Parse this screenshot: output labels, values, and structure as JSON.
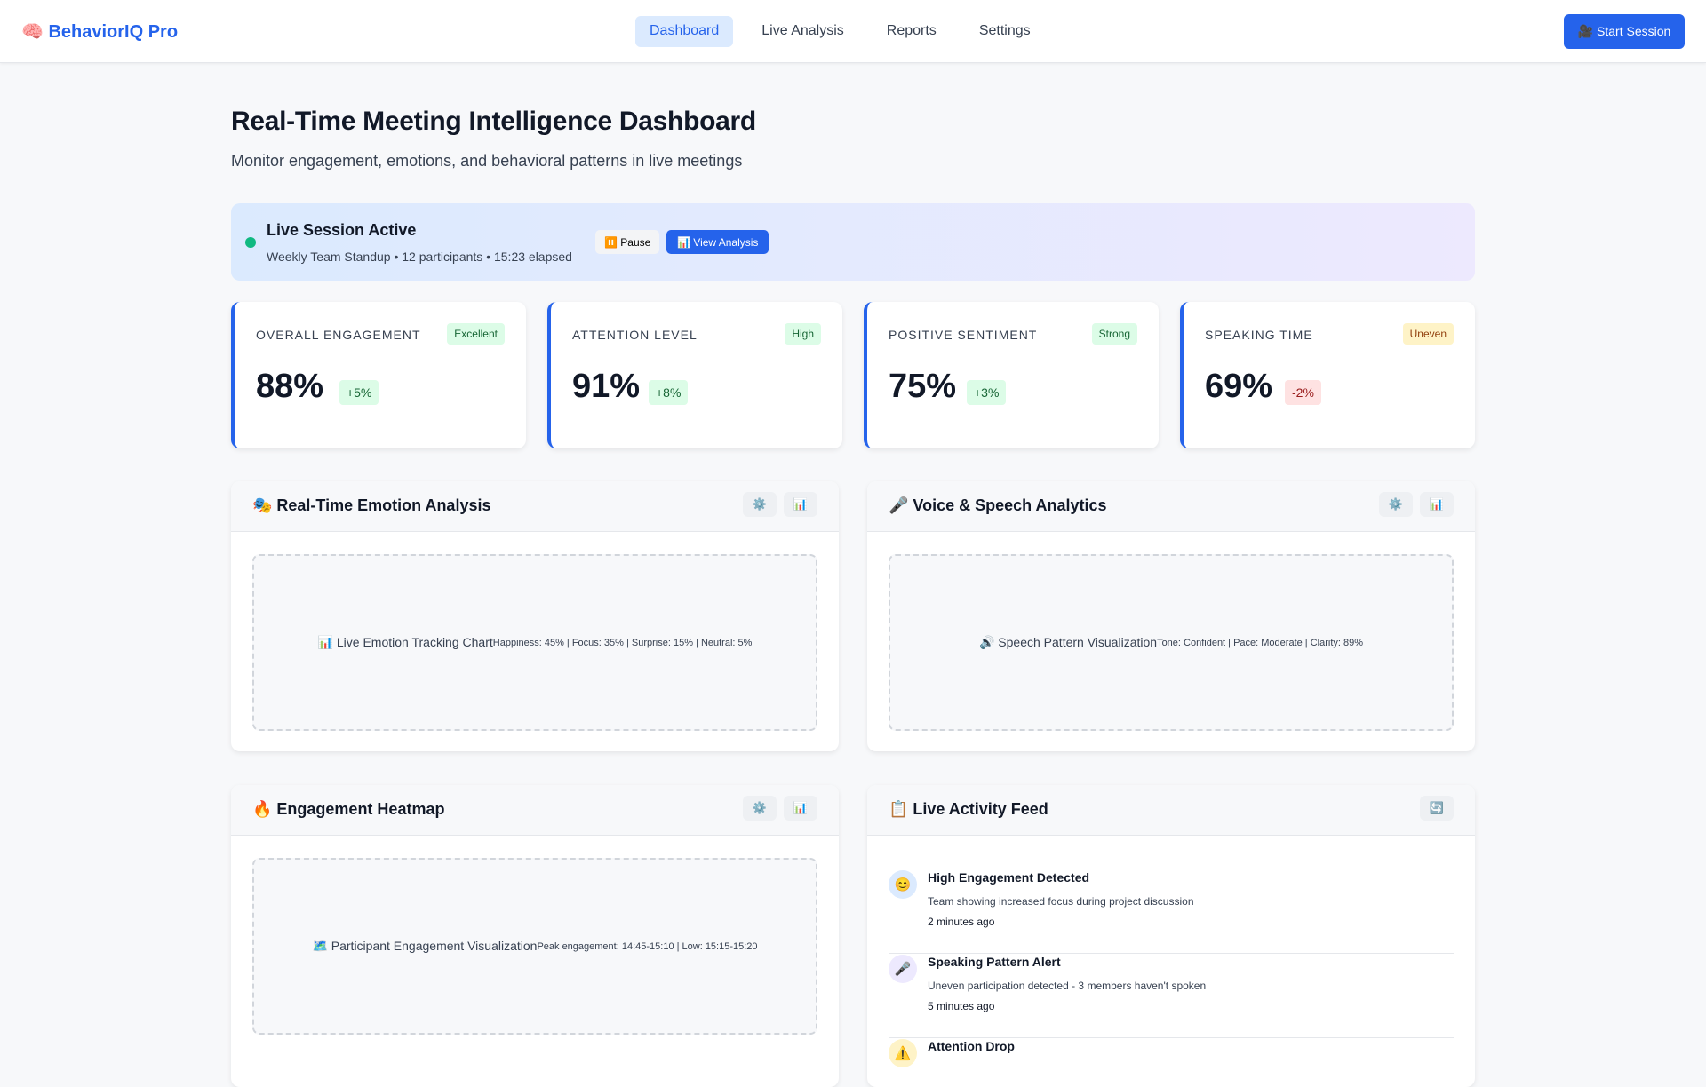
{
  "nav": {
    "logo": "🧠 BehaviorIQ Pro",
    "links": [
      "Dashboard",
      "Live Analysis",
      "Reports",
      "Settings"
    ],
    "start": "🎥 Start Session"
  },
  "header": {
    "title": "Real-Time Meeting Intelligence Dashboard",
    "subtitle": "Monitor engagement, emotions, and behavioral patterns in live meetings"
  },
  "session": {
    "title": "Live Session Active",
    "details": "Weekly Team Standup • 12 participants • 15:23 elapsed",
    "pause": "⏸️ Pause",
    "view": "📊 View Analysis"
  },
  "metrics": [
    {
      "label": "OVERALL ENGAGEMENT",
      "badge": "Excellent",
      "value": "88%",
      "change": "+5%"
    },
    {
      "label": "ATTENTION LEVEL",
      "badge": "High",
      "value": "91%",
      "change": "+8%"
    },
    {
      "label": "POSITIVE SENTIMENT",
      "badge": "Strong",
      "value": "75%",
      "change": "+3%"
    },
    {
      "label": "SPEAKING TIME",
      "badge": "Uneven",
      "value": "69%",
      "change": "-2%"
    }
  ],
  "panels": {
    "emotion": {
      "title": "🎭 Real-Time Emotion Analysis",
      "ph": "📊 Live Emotion Tracking Chart",
      "detail": "Happiness: 45% | Focus: 35% | Surprise: 15% | Neutral: 5%"
    },
    "voice": {
      "title": "🎤 Voice & Speech Analytics",
      "ph": "🔊 Speech Pattern Visualization",
      "detail": "Tone: Confident | Pace: Moderate | Clarity: 89%"
    },
    "heatmap": {
      "title": "🔥 Engagement Heatmap",
      "ph": "🗺️ Participant Engagement Visualization",
      "detail": "Peak engagement: 14:45-15:10 | Low: 15:15-15:20"
    },
    "feed": {
      "title": "📋 Live Activity Feed",
      "items": [
        {
          "icon": "😊",
          "title": "High Engagement Detected",
          "desc": "Team showing increased focus during project discussion",
          "time": "2 minutes ago"
        },
        {
          "icon": "🎤",
          "title": "Speaking Pattern Alert",
          "desc": "Uneven participation detected - 3 members haven't spoken",
          "time": "5 minutes ago"
        },
        {
          "icon": "⚠️",
          "title": "Attention Drop"
        }
      ]
    }
  },
  "icons": {
    "settings": "⚙️",
    "chart": "📊",
    "refresh": "🔄"
  }
}
